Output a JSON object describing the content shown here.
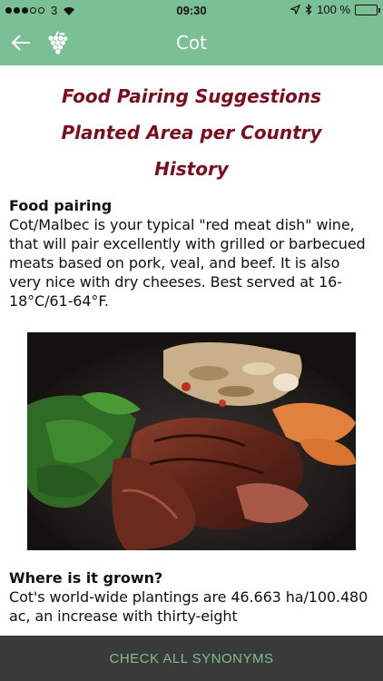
{
  "status_bar": {
    "carrier": "3",
    "time": "09:30",
    "battery_text": "100 %",
    "signal_bars_filled": 3,
    "signal_bars_total": 5
  },
  "header": {
    "title": "Cot"
  },
  "menu": {
    "items": [
      "Food Pairing Suggestions",
      "Planted Area per Country",
      "History"
    ]
  },
  "food_pairing": {
    "heading": "Food pairing",
    "text": "Cot/Malbec is your typical \"red meat dish\" wine, that will pair excellently with grilled or barbecued meats based on pork, veal, and beef. It is also very nice with dry cheeses. Best served at 16-18°C/61-64°F."
  },
  "grown": {
    "heading": "Where is it grown?",
    "text": "Cot's world-wide plantings are 46.663 ha/100.480 ac, an increase with thirty-eight"
  },
  "bottom_bar": {
    "label": "CHECK ALL SYNONYMS"
  },
  "colors": {
    "header_green": "#7bbf95",
    "link_maroon": "#7a0e1e",
    "bottom_bar": "#3a3a3a"
  }
}
